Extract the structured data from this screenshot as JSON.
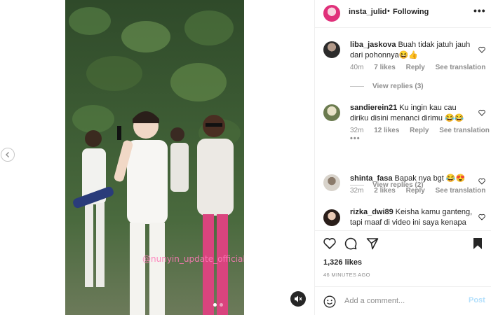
{
  "post": {
    "username": "insta_julid",
    "separator": "•",
    "follow_status": "Following",
    "more_label": "•••",
    "watermark": "@nunyin_update_official"
  },
  "comments": [
    {
      "username": "liba_jaskova",
      "text": "Buah tidak jatuh jauh dari pohonnya😆👍",
      "time": "40m",
      "likes": "7 likes",
      "reply": "Reply",
      "translate": "See translation",
      "view_replies": "View replies (3)"
    },
    {
      "username": "sandierein21",
      "text": "Ku ingin kau cau diriku disini menanci dirimu 😂😂",
      "time": "32m",
      "likes": "12 likes",
      "reply": "Reply",
      "translate": "See translation",
      "ellipsis": "•••",
      "view_replies": "View replies (2)"
    },
    {
      "username": "shinta_fasa",
      "text": "Bapak nya bgt 😂😍",
      "time": "32m",
      "likes": "2 likes",
      "reply": "Reply",
      "translate": "See translation"
    },
    {
      "username": "rizka_dwi89",
      "text": "Keisha kamu ganteng, tapi maaf di video ini saya kenapa"
    }
  ],
  "actions": {
    "likes_count": "1,326 likes",
    "time_ago": "46 MINUTES AGO"
  },
  "composer": {
    "placeholder": "Add a comment...",
    "post_label": "Post"
  },
  "colors": {
    "brand_accent": "#e0307a",
    "post_disabled": "#b2dffc",
    "muted_text": "#8e8e8e"
  },
  "icons": [
    "chevron-left-icon",
    "mute-icon",
    "more-icon",
    "heart-icon",
    "comment-icon",
    "share-icon",
    "bookmark-icon",
    "emoji-icon"
  ]
}
